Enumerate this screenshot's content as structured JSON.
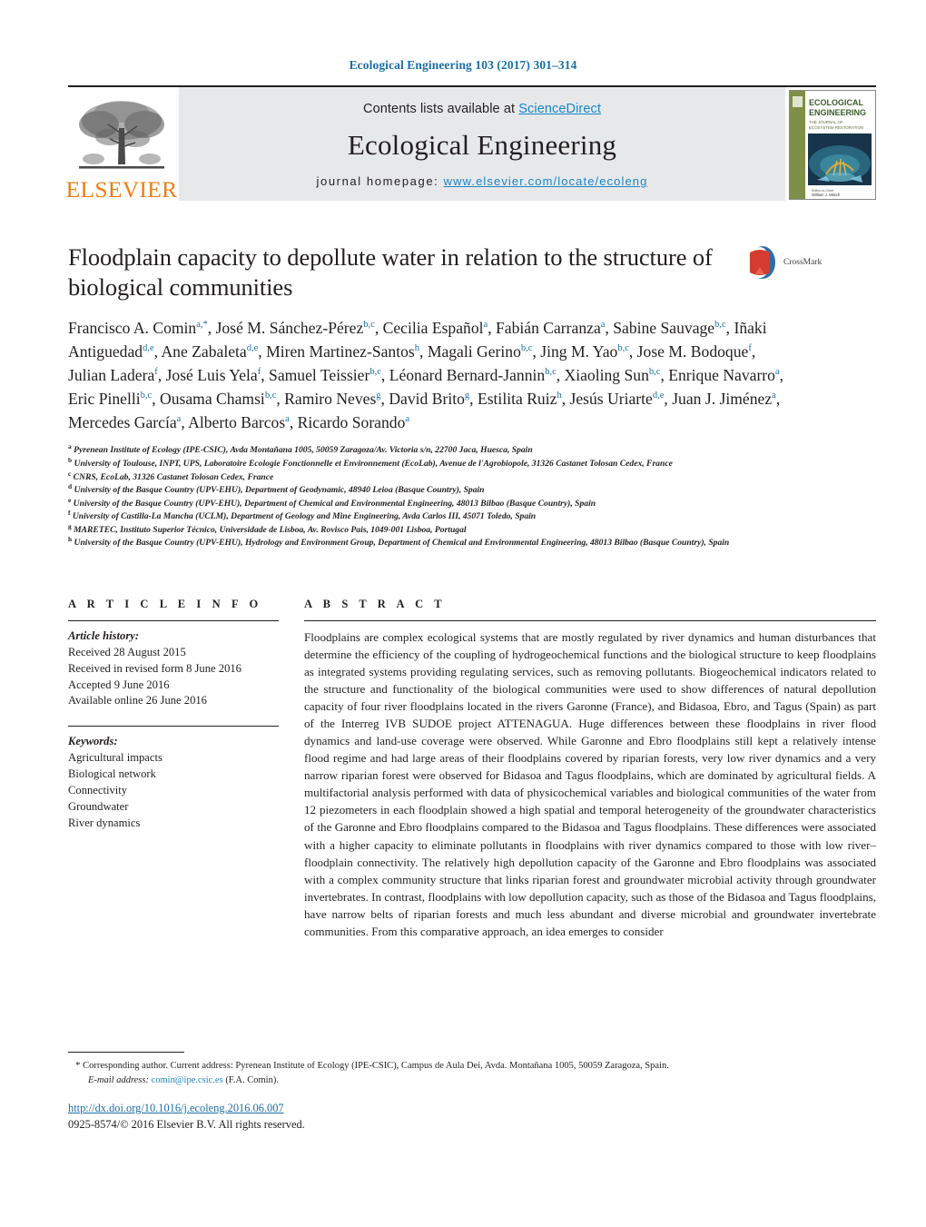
{
  "running_head": "Ecological Engineering 103 (2017) 301–314",
  "masthead": {
    "publisher_name": "ELSEVIER",
    "contents_prefix": "Contents lists available at ",
    "contents_link": "ScienceDirect",
    "journal_title": "Ecological Engineering",
    "homepage_prefix": "journal homepage: ",
    "homepage_url": "www.elsevier.com/locate/ecoleng",
    "cover": {
      "line1": "ECOLOGICAL",
      "line2": "ENGINEERING",
      "line3": "THE JOURNAL OF",
      "line4": "ECOSYSTEM RESTORATION",
      "footer1": "Editor-in-Chief",
      "footer2": "William J. Mitsch"
    }
  },
  "article": {
    "title": "Floodplain capacity to depollute water in relation to the structure of biological communities",
    "crossmark_label": "CrossMark",
    "authors_html": "Francisco A. Comin<sup>a,*</sup>, José M. Sánchez-Pérez<sup>b,c</sup>, Cecilia Español<sup>a</sup>, Fabián Carranza<sup>a</sup>, Sabine Sauvage<sup>b,c</sup>, Iñaki Antiguedad<sup>d,e</sup>, Ane Zabaleta<sup>d,e</sup>, Miren Martinez-Santos<sup>h</sup>, Magali Gerino<sup>b,c</sup>, Jing M. Yao<sup>b,c</sup>, Jose M. Bodoque<sup>f</sup>, Julian Ladera<sup>f</sup>, José Luis Yela<sup>f</sup>, Samuel Teissier<sup>b,c</sup>, Léonard Bernard-Jannin<sup>b,c</sup>, Xiaoling Sun<sup>b,c</sup>, Enrique Navarro<sup>a</sup>, Eric Pinelli<sup>b,c</sup>, Ousama Chamsi<sup>b,c</sup>, Ramiro Neves<sup>g</sup>, David Brito<sup>g</sup>, Estilita Ruiz<sup>h</sup>, Jesús Uriarte<sup>d,e</sup>, Juan J. Jiménez<sup>a</sup>, Mercedes García<sup>a</sup>, Alberto Barcos<sup>a</sup>, Ricardo Sorando<sup>a</sup>",
    "affiliations_html": "<p class=\"aff\"><sup>a</sup> Pyrenean Institute of Ecology (IPE-CSIC), Avda Montañana 1005, 50059 Zaragoza/Av. Victoria s/n, 22700 Jaca, Huesca, Spain</p><p class=\"aff\"><sup>b</sup> University of Toulouse, INPT, UPS, Laboratoire Ecologie Fonctionnelle et Environnement (EcoLab), Avenue de l'Agrobiopole, 31326 Castanet Tolosan Cedex, France</p><p class=\"aff\"><sup>c</sup> CNRS, EcoLab, 31326 Castanet Tolosan Cedex, France</p><p class=\"aff\"><sup>d</sup> University of the Basque Country (UPV-EHU), Department of Geodynamic, 48940 Leioa (Basque Country), Spain</p><p class=\"aff\"><sup>e</sup> University of the Basque Country (UPV-EHU), Department of Chemical and Environmental Engineering, 48013 Bilbao (Basque Country), Spain</p><p class=\"aff\"><sup>f</sup> University of Castilla-La Mancha (UCLM), Department of Geology and Mine Engineering, Avda Carlos III, 45071 Toledo, Spain</p><p class=\"aff\"><sup>g</sup> MARETEC, Instituto Superior Técnico, Universidade de Lisboa, Av. Rovisco Pais, 1049-001 Lisboa, Portugal</p><p class=\"aff\"><sup>h</sup> University of the Basque Country (UPV-EHU), Hydrology and Environment Group, Department of Chemical and Environmental Engineering, 48013 Bilbao (Basque Country), Spain</p>"
  },
  "article_info": {
    "heading": "A R T I C L E   I N F O",
    "history_label": "Article history:",
    "history": [
      "Received 28 August 2015",
      "Received in revised form 8 June 2016",
      "Accepted 9 June 2016",
      "Available online 26 June 2016"
    ],
    "keywords_label": "Keywords:",
    "keywords": [
      "Agricultural impacts",
      "Biological network",
      "Connectivity",
      "Groundwater",
      "River dynamics"
    ]
  },
  "abstract": {
    "heading": "A B S T R A C T",
    "text": "Floodplains are complex ecological systems that are mostly regulated by river dynamics and human disturbances that determine the efficiency of the coupling of hydrogeochemical functions and the biological structure to keep floodplains as integrated systems providing regulating services, such as removing pollutants. Biogeochemical indicators related to the structure and functionality of the biological communities were used to show differences of natural depollution capacity of four river floodplains located in the rivers Garonne (France), and Bidasoa, Ebro, and Tagus (Spain) as part of the Interreg IVB SUDOE project ATTENAGUA. Huge differences between these floodplains in river flood dynamics and land-use coverage were observed. While Garonne and Ebro floodplains still kept a relatively intense flood regime and had large areas of their floodplains covered by riparian forests, very low river dynamics and a very narrow riparian forest were observed for Bidasoa and Tagus floodplains, which are dominated by agricultural fields. A multifactorial analysis performed with data of physicochemical variables and biological communities of the water from 12 piezometers in each floodplain showed a high spatial and temporal heterogeneity of the groundwater characteristics of the Garonne and Ebro floodplains compared to the Bidasoa and Tagus floodplains. These differences were associated with a higher capacity to eliminate pollutants in floodplains with river dynamics compared to those with low river–floodplain connectivity. The relatively high depollution capacity of the Garonne and Ebro floodplains was associated with a complex community structure that links riparian forest and groundwater microbial activity through groundwater invertebrates. In contrast, floodplains with low depollution capacity, such as those of the Bidasoa and Tagus floodplains, have narrow belts of riparian forests and much less abundant and diverse microbial and groundwater invertebrate communities. From this comparative approach, an idea emerges to consider"
  },
  "footnotes": {
    "corresponding_marker": "*",
    "corresponding_text": "Corresponding author. Current address: Pyrenean Institute of Ecology (IPE-CSIC), Campus de Aula Dei, Avda. Montañana 1005, 50059 Zaragoza, Spain.",
    "email_label": "E-mail address:",
    "email": "comin@ipe.csic.es",
    "email_suffix": "(F.A. Comin).",
    "doi": "http://dx.doi.org/10.1016/j.ecoleng.2016.06.007",
    "copyright": "0925-8574/© 2016 Elsevier B.V. All rights reserved."
  },
  "colors": {
    "link_blue": "#1a86c8",
    "header_blue": "#1a6fa8",
    "elsevier_orange": "#ee7d11",
    "masthead_grey": "#e7e8ea",
    "text_black": "#231f20"
  }
}
